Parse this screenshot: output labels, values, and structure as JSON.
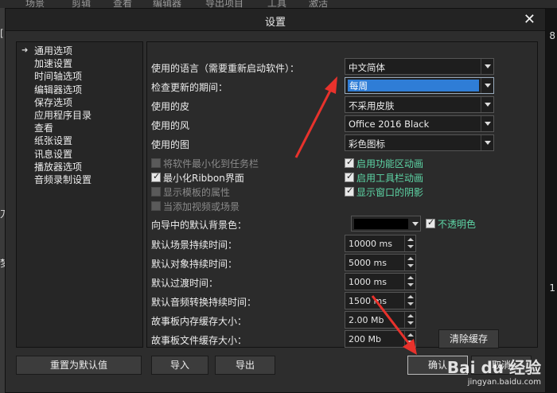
{
  "background": {
    "menu_items": [
      "场景",
      "剪辑",
      "查看",
      "编辑器",
      "导出项目",
      "工具",
      "激活"
    ],
    "left_glyphs": [
      "[",
      "刀",
      "梦"
    ],
    "right_glyphs": [
      "8",
      "1"
    ]
  },
  "dialog": {
    "title": "设置",
    "close_icon": "close-icon"
  },
  "sidebar": {
    "items": [
      {
        "label": "通用选项",
        "selected": true
      },
      {
        "label": "加速设置"
      },
      {
        "label": "时间轴选项"
      },
      {
        "label": "编辑器选项"
      },
      {
        "label": "保存选项"
      },
      {
        "label": "应用程序目录"
      },
      {
        "label": "查看"
      },
      {
        "label": "纸张设置"
      },
      {
        "label": "讯息设置"
      },
      {
        "label": "播放器选项"
      },
      {
        "label": "音频录制设置"
      }
    ]
  },
  "general": {
    "language_label": "使用的语言（需要重新启动软件）：",
    "language_value": "中文简体",
    "update_label": "检查更新的期间：",
    "update_value": "每周",
    "skin_label": "使用的皮",
    "skin_value": "不采用皮肤",
    "style_label": "使用的风",
    "style_value": "Office 2016 Black",
    "icon_label": "使用的图",
    "icon_value": "彩色图标"
  },
  "checkboxes": {
    "minimize_to_tray": {
      "label": "将软件最小化到任务栏",
      "checked": false,
      "disabled": true
    },
    "minimize_ribbon": {
      "label": "最小化Ribbon界面",
      "checked": true,
      "disabled": false
    },
    "show_template_props": {
      "label": "显示模板的属性",
      "checked": false,
      "disabled": true
    },
    "when_add_video": {
      "label": "当添加视频或场景",
      "checked": false,
      "disabled": true
    },
    "enable_ribbon_anim": {
      "label": "启用功能区动画",
      "checked": true,
      "disabled": false
    },
    "enable_toolbar_anim": {
      "label": "启用工具栏动画",
      "checked": true,
      "disabled": false
    },
    "show_window_shadow": {
      "label": "显示窗口的阴影",
      "checked": true,
      "disabled": false
    }
  },
  "wizard": {
    "bg_color_label": "向导中的默认背景色：",
    "bg_color": "#000000",
    "opaque_label": "不透明色",
    "opaque_checked": true
  },
  "durations": {
    "scene_label": "默认场景持续时间：",
    "scene_value": "10000 ms",
    "object_label": "默认对象持续时间：",
    "object_value": "5000 ms",
    "transition_label": "默认过渡时间：",
    "transition_value": "1000 ms",
    "audio_label": "默认音频转换持续时间：",
    "audio_value": "1500 ms",
    "mem_cache_label": "故事板内存缓存大小：",
    "mem_cache_value": "2.00 Mb",
    "file_cache_label": "故事板文件缓存大小：",
    "file_cache_value": "200 Mb"
  },
  "buttons": {
    "clear_cache": "清除缓存",
    "reset_default": "重置为默认值",
    "import": "导入",
    "export": "导出",
    "ok": "确认",
    "cancel": "取消"
  },
  "watermark": {
    "brand": "Bai du 经验",
    "url": "jingyan.baidu.com"
  },
  "colors": {
    "annotation_red": "#e8322c",
    "selection_blue": "#2f7dd6",
    "green_text": "#5ed6a6"
  }
}
